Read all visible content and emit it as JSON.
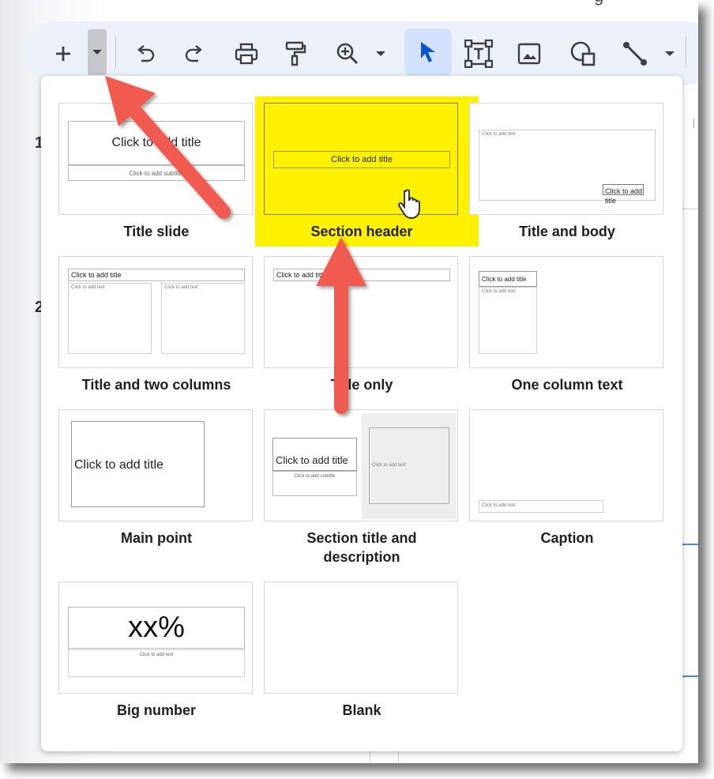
{
  "header": {
    "partial_text": "g"
  },
  "toolbar": {
    "buttons": [
      {
        "name": "new-slide-button",
        "icon": "plus-icon"
      },
      {
        "name": "layout-dropdown-button",
        "icon": "caret-down-icon"
      },
      {
        "name": "undo-button",
        "icon": "undo-icon"
      },
      {
        "name": "redo-button",
        "icon": "redo-icon"
      },
      {
        "name": "print-button",
        "icon": "print-icon"
      },
      {
        "name": "paint-format-button",
        "icon": "paint-roller-icon"
      },
      {
        "name": "zoom-button",
        "icon": "zoom-in-icon"
      },
      {
        "name": "zoom-dropdown-button",
        "icon": "caret-down-icon"
      },
      {
        "name": "select-tool-button",
        "icon": "cursor-arrow-icon"
      },
      {
        "name": "text-box-button",
        "icon": "text-box-icon"
      },
      {
        "name": "insert-image-button",
        "icon": "image-icon"
      },
      {
        "name": "shape-button",
        "icon": "shape-icon"
      },
      {
        "name": "line-button",
        "icon": "line-icon"
      },
      {
        "name": "line-dropdown-button",
        "icon": "caret-down-icon"
      }
    ]
  },
  "side_numbers": [
    "1",
    "2"
  ],
  "layouts": [
    {
      "label": "Title slide",
      "title_text": "Click to add title",
      "subtitle_text": "Click to add subtitle"
    },
    {
      "label": "Section header",
      "title_text": "Click to add title",
      "highlighted": true
    },
    {
      "label": "Title and body",
      "body_text": "Click to add text",
      "title_text": "Click to add title"
    },
    {
      "label": "Title and two columns",
      "title_text": "Click to add title",
      "col1_text": "Click to add text",
      "col2_text": "Click to add text"
    },
    {
      "label": "Title only",
      "title_text": "Click to add title"
    },
    {
      "label": "One column text",
      "title_text": "Click to add title",
      "body_text": "Click to add text"
    },
    {
      "label": "Main point",
      "title_text": "Click to add title"
    },
    {
      "label": "Section title and description",
      "title_text": "Click to add title",
      "subtitle_text": "Click to add subtitle",
      "body_text": "Click to add text"
    },
    {
      "label": "Caption",
      "body_text": "Click to add text"
    },
    {
      "label": "Big number",
      "title_text": "xx%",
      "body_text": "Click to add text"
    },
    {
      "label": "Blank"
    }
  ],
  "colors": {
    "highlight": "#fff200",
    "arrow": "#f05a4f",
    "toolbar_bg": "#edf2fa",
    "active_button": "#d3e3fd"
  }
}
